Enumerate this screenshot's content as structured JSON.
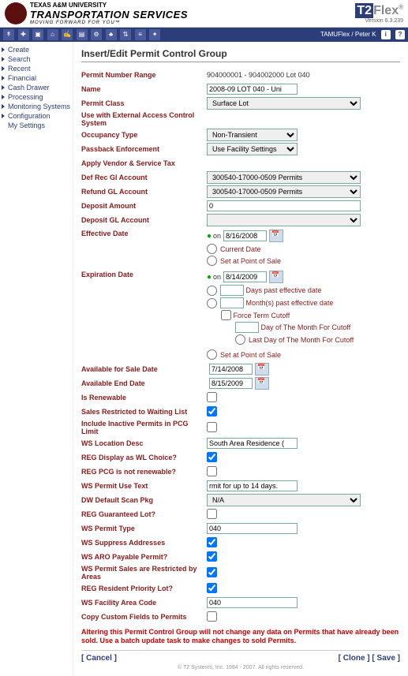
{
  "header": {
    "university": "TEXAS A&M UNIVERSITY",
    "service": "TRANSPORTATION SERVICES",
    "tagline": "MOVING FORWARD FOR YOU™",
    "product_t2": "T2",
    "product_flex": "Flex",
    "version": "Version 6.3.239"
  },
  "userbar": {
    "right": "TAMUFlex / Peter K",
    "help": "?",
    "info": "i"
  },
  "sidebar": {
    "items": [
      {
        "label": "Create"
      },
      {
        "label": "Search"
      },
      {
        "label": "Recent"
      },
      {
        "label": "Financial"
      },
      {
        "label": "Cash Drawer"
      },
      {
        "label": "Processing"
      },
      {
        "label": "Monitoring Systems"
      },
      {
        "label": "Configuration"
      },
      {
        "label": "My Settings"
      }
    ]
  },
  "page": {
    "title": "Insert/Edit Permit Control Group"
  },
  "form": {
    "permit_number_range": {
      "label": "Permit Number Range",
      "value": "904000001 - 904002000 Lot 040"
    },
    "name": {
      "label": "Name",
      "value": "2008-09 LOT 040 - Uni"
    },
    "permit_class": {
      "label": "Permit Class",
      "value": "Surface Lot"
    },
    "use_ext_acs": {
      "label": "Use with External Access Control System"
    },
    "occupancy_type": {
      "label": "Occupancy Type",
      "value": "Non-Transient"
    },
    "passback": {
      "label": "Passback Enforcement",
      "value": "Use Facility Settings"
    },
    "apply_vendor_tax": {
      "label": "Apply Vendor & Service Tax"
    },
    "def_rec_gl": {
      "label": "Def Rec Gl Account",
      "value": "300540-17000-0509 Permits"
    },
    "refund_gl": {
      "label": "Refund GL Account",
      "value": "300540-17000-0509 Permits"
    },
    "deposit_amount": {
      "label": "Deposit Amount",
      "value": "0"
    },
    "deposit_gl": {
      "label": "Deposit GL Account",
      "value": ""
    },
    "effective_date": {
      "label": "Effective Date",
      "value": "8/16/2008",
      "opts": {
        "on": "on",
        "current": "Current Date",
        "pos": "Set at Point of Sale"
      }
    },
    "expiration_date": {
      "label": "Expiration Date",
      "value": "8/14/2009",
      "opts": {
        "on": "on",
        "days_past": "Days past effective date",
        "months_past": "Month(s) past effective date",
        "force": "Force Term Cutoff",
        "force_day": "Day of The Month For Cutoff",
        "force_last": "Last Day of The Month For Cutoff",
        "pos": "Set at Point of Sale"
      }
    },
    "avail_sale_date": {
      "label": "Available for Sale Date",
      "value": "7/14/2008"
    },
    "avail_end_date": {
      "label": "Available End Date",
      "value": "8/15/2009"
    },
    "is_renewable": {
      "label": "Is Renewable"
    },
    "sales_wait": {
      "label": "Sales Restricted to Waiting List"
    },
    "include_inactive": {
      "label": "Include Inactive Permits in PCG Limit"
    },
    "ws_loc_desc": {
      "label": "WS Location Desc",
      "value": "South Area Residence ("
    },
    "reg_display_wl": {
      "label": "REG Display as WL Choice?"
    },
    "reg_pcg_nonrenew": {
      "label": "REG PCG is not renewable?"
    },
    "ws_permit_use": {
      "label": "WS Permit Use Text",
      "value": "rmit for up to 14 days."
    },
    "dw_default_scan": {
      "label": "DW Default Scan Pkg",
      "value": "N/A"
    },
    "reg_guaranteed": {
      "label": "REG Guaranteed Lot?"
    },
    "ws_permit_type": {
      "label": "WS Permit Type",
      "value": "040"
    },
    "ws_suppress_addr": {
      "label": "WS Suppress Addresses"
    },
    "ws_aro_payable": {
      "label": "WS ARO Payable Permit?"
    },
    "ws_sales_area": {
      "label": "WS Permit Sales are Restricted by Areas"
    },
    "reg_resident": {
      "label": "REG Resident Priority Lot?"
    },
    "ws_fac_area": {
      "label": "WS Facility Area Code",
      "value": "040"
    },
    "copy_custom": {
      "label": "Copy Custom Fields to Permits"
    }
  },
  "note": "Altering this Permit Control Group will not change any data on Permits that have already been sold. Use a batch update task to make changes to sold Permits.",
  "actions": {
    "cancel": "[ Cancel ]",
    "clone": "[ Clone ]",
    "save": "[ Save ]"
  },
  "footer": "© T2 Systems, Inc. 1994 - 2007. All rights reserved."
}
